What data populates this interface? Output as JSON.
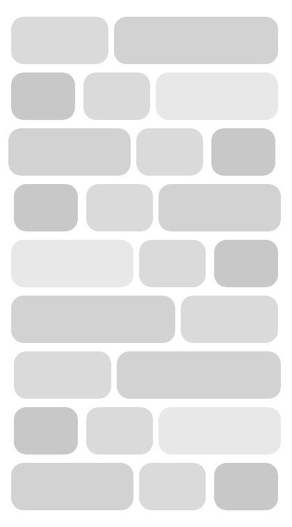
{
  "screen": {
    "title": "",
    "state": "loading-skeleton"
  },
  "colors": {
    "background": "#ffffff",
    "skeleton_dark": "#c8c8c8",
    "skeleton_mid": "#d2d2d2",
    "skeleton_light": "#dadada",
    "skeleton_faint": "#e8e8e8"
  },
  "rows": [
    {
      "pills": [
        "skeleton_light",
        "skeleton_mid"
      ]
    },
    {
      "pills": [
        "skeleton_dark",
        "skeleton_light",
        "skeleton_faint"
      ]
    },
    {
      "pills": [
        "skeleton_mid",
        "skeleton_light",
        "skeleton_dark"
      ]
    },
    {
      "pills": [
        "skeleton_dark",
        "skeleton_light",
        "skeleton_mid"
      ]
    },
    {
      "pills": [
        "skeleton_faint",
        "skeleton_light",
        "skeleton_dark"
      ]
    },
    {
      "pills": [
        "skeleton_mid",
        "skeleton_light"
      ]
    },
    {
      "pills": [
        "skeleton_light",
        "skeleton_mid"
      ]
    },
    {
      "pills": [
        "skeleton_dark",
        "skeleton_light",
        "skeleton_faint"
      ]
    },
    {
      "pills": [
        "skeleton_mid",
        "skeleton_light",
        "skeleton_dark"
      ]
    }
  ]
}
